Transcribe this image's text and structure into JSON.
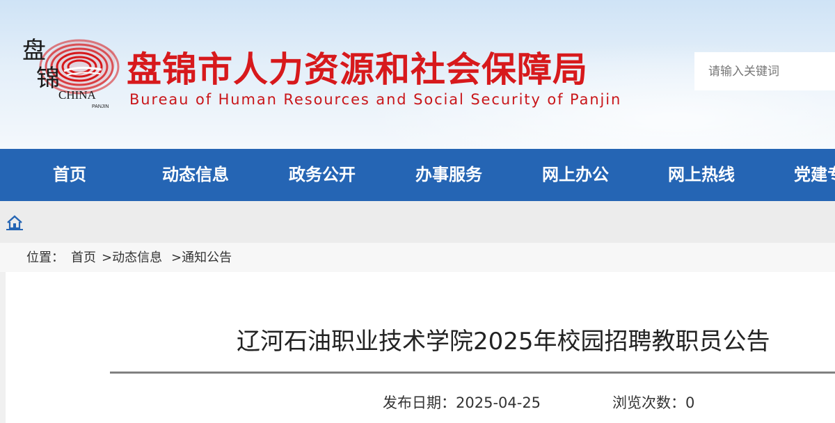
{
  "header": {
    "title": "盘锦市人力资源和社会保障局",
    "subtitle": "Bureau of Human Resources and Social Security of Panjin",
    "logo": {
      "char_1": "盘",
      "char_2": "锦",
      "word": "CHINA",
      "sub_word": "PANJIN",
      "colors": {
        "primary": "#d7191c",
        "ink": "#1a1a1a"
      }
    }
  },
  "search": {
    "placeholder": "请输入关键词"
  },
  "nav": {
    "items": [
      {
        "label": "首页"
      },
      {
        "label": "动态信息"
      },
      {
        "label": "政务公开"
      },
      {
        "label": "办事服务"
      },
      {
        "label": "网上办公"
      },
      {
        "label": "网上热线"
      },
      {
        "label": "党建专"
      }
    ],
    "colors": {
      "background": "#2565b4",
      "text": "#ffffff"
    }
  },
  "home_bar": {
    "icon": "home-icon"
  },
  "breadcrumb": {
    "label": "位置：",
    "items": [
      {
        "label": "首页"
      },
      {
        "label": ">动态信息"
      },
      {
        "label": ">通知公告"
      }
    ]
  },
  "article": {
    "title": "辽河石油职业技术学院2025年校园招聘教职员公告",
    "publish_date_label": "发布日期：",
    "publish_date": "2025-04-25",
    "views_label": "浏览次数：",
    "views": "0"
  }
}
